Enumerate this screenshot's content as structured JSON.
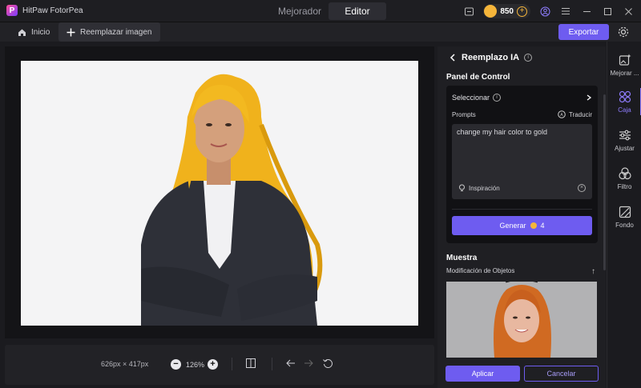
{
  "app": {
    "name": "HitPaw FotorPea"
  },
  "mode_tabs": [
    {
      "label": "Mejorador",
      "active": false
    },
    {
      "label": "Editor",
      "active": true
    }
  ],
  "credits": "850",
  "toolbar": {
    "home_label": "Inicio",
    "replace_label": "Reemplazar imagen",
    "export_label": "Exportar"
  },
  "canvas": {
    "dimensions": "626px × 417px",
    "zoom": "126%"
  },
  "panel": {
    "title": "Reemplazo IA",
    "control_title": "Panel de Control",
    "select_label": "Seleccionar",
    "prompts_label": "Prompts",
    "translate_label": "Traducir",
    "prompt_text": "change my hair color to gold",
    "inspiration_label": "Inspiración",
    "generate_label": "Generar",
    "generate_cost": "4",
    "sample_title": "Muestra",
    "sample_subtitle": "Modificación de Objetos",
    "apply_label": "Aplicar",
    "cancel_label": "Cancelar"
  },
  "sidenav": [
    {
      "label": "Mejorar ...",
      "icon": "sparkle-image-icon",
      "active": false
    },
    {
      "label": "Caja",
      "icon": "grid-circles-icon",
      "active": true
    },
    {
      "label": "Ajustar",
      "icon": "sliders-icon",
      "active": false
    },
    {
      "label": "Filtro",
      "icon": "overlap-circles-icon",
      "active": false
    },
    {
      "label": "Fondo",
      "icon": "background-icon",
      "active": false
    }
  ],
  "colors": {
    "accent": "#6e5cf0",
    "active_nav": "#8f7dff",
    "coin": "#f5b53a"
  }
}
